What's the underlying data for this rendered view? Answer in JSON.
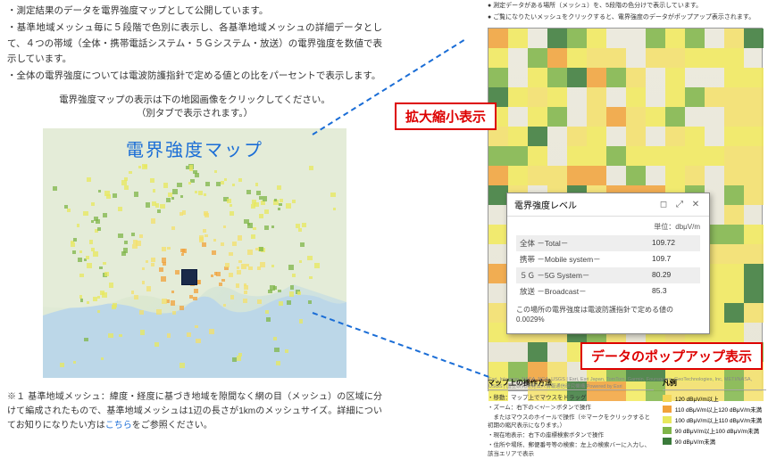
{
  "left": {
    "bullets": [
      "・測定結果のデータを電界強度マップとして公開しています。",
      "・基準地域メッシュ毎に５段階で色別に表示し、各基準地域メッシュの詳細データとして、４つの帯域（全体・携帯電話システム・５Ｇシステム・放送）の電界強度を数値で表示しています。",
      "・全体の電界強度については電波防護指針で定める値との比をパーセントで表示します。"
    ],
    "caption1": "電界強度マップの表示は下の地図画像をクリックしてください。",
    "caption2": "（別タブで表示されます。）",
    "map_title": "電界強度マップ",
    "footnote": "※１ 基準地域メッシュ：緯度・経度に基づき地域を隙間なく網の目（メッシュ）の区域に分けて編成されたもので、基準地域メッシュは1辺の長さが1kmのメッシュサイズ。詳細についてお知りになりたい方は",
    "kochira": "こちら",
    "footnote_end": "をご参照ください。"
  },
  "right": {
    "notes": [
      "● 測定データがある場所（メッシュ）を、5段階の色分けで表示しています。",
      "● ご覧になりたいメッシュをクリックすると、電界強度のデータがポップアップ表示されます。"
    ],
    "credit": "Esri, Intermap, NASA, NGA, USGS | Esri, Esri Japan, TomTom, Garmin, Foursquare, GeoTechnologies, Inc, METI/NASA, USGS | 国立研究開発法人情報通信研究機構    Powered by Esri"
  },
  "popup": {
    "title": "電界強度レベル",
    "unit": "単位：dbμV/m",
    "rows": [
      {
        "label": "全体 －Total－",
        "val": "109.72"
      },
      {
        "label": "携帯 －Mobile system－",
        "val": "109.7"
      },
      {
        "label": "５Ｇ －5G System－",
        "val": "80.29"
      },
      {
        "label": "放送 －Broadcast－",
        "val": "85.3"
      }
    ],
    "foot": "この場所の電界強度は電波防護指針で定める値の0.0029%"
  },
  "callouts": {
    "zoom": "拡大縮小表示",
    "popup": "データのポップアップ表示"
  },
  "bottom": {
    "ops_title": "マップ上の操作方法",
    "ops": [
      "・移動：マップ上でマウスをドラッグ",
      "・ズーム：右下の＜+/－＞ボタンで操作",
      "　またはマウスのホイールで操作（※マークをクリックすると初期の縮尺表示になります。）",
      "・現在地表示：右下の座標検索ボタンで操作",
      "・住所や場所、郵便番号等の検索：左上の検索バーに入力し、該当エリアで表示"
    ],
    "legend_title": "凡例",
    "legend": [
      {
        "c": "#f4d554",
        "t": "120 dBμV/m以上"
      },
      {
        "c": "#f2a23a",
        "t": "110 dBμV/m以上120 dBμV/m未満"
      },
      {
        "c": "#e8e85c",
        "t": "100 dBμV/m以上110 dBμV/m未満"
      },
      {
        "c": "#7fb548",
        "t": "90 dBμV/m以上100 dBμV/m未満"
      },
      {
        "c": "#3a7a3a",
        "t": "90 dBμV/m未満"
      }
    ]
  }
}
